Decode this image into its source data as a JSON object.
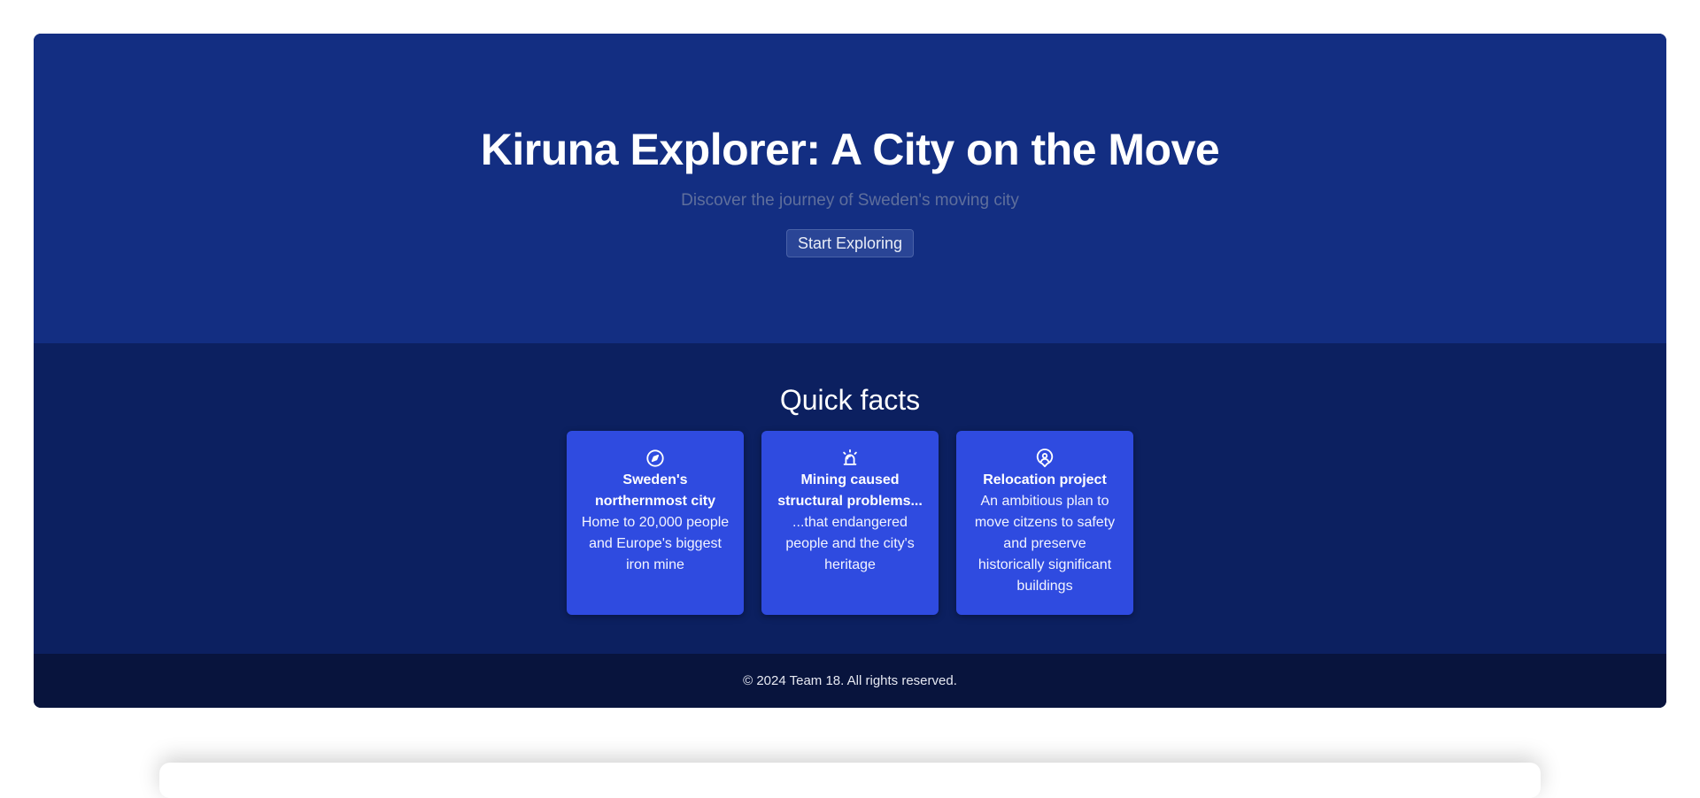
{
  "hero": {
    "title": "Kiruna Explorer: A City on the Move",
    "subtitle": "Discover the journey of Sweden's moving city",
    "button_label": "Start Exploring"
  },
  "facts": {
    "title": "Quick facts",
    "cards": [
      {
        "icon": "compass-icon",
        "title": "Sweden's northernmost city",
        "text": "Home to 20,000 people and Europe's biggest iron mine"
      },
      {
        "icon": "siren-icon",
        "title": "Mining caused structural problems...",
        "text": "...that endangered people and the city's heritage"
      },
      {
        "icon": "location-person-icon",
        "title": "Relocation project",
        "text": "An ambitious plan to move citzens to safety and preserve historically significant buildings"
      }
    ]
  },
  "footer": {
    "text": "© 2024 Team 18. All rights reserved."
  },
  "colors": {
    "hero_bg": "#132e82",
    "facts_bg": "#0c2060",
    "card_bg": "#2f4be0",
    "footer_bg": "#08143d"
  }
}
